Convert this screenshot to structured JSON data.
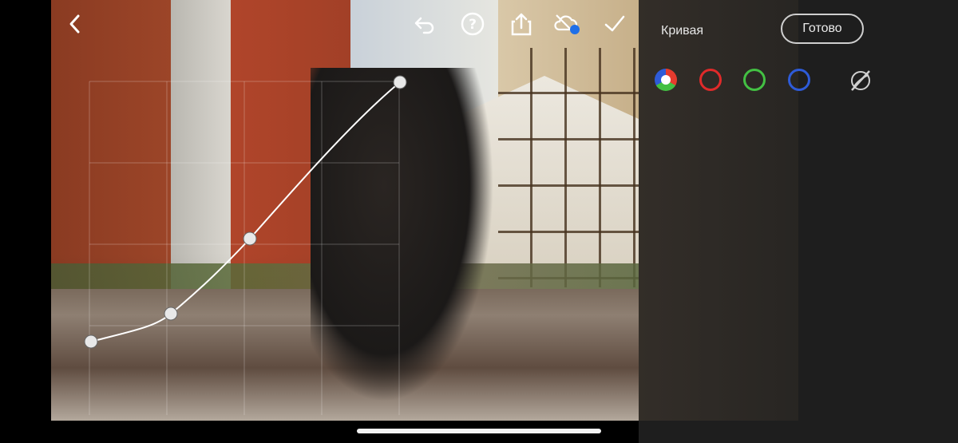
{
  "toolbar": {
    "icons": [
      "back-chevron-icon",
      "undo-icon",
      "help-icon",
      "share-icon",
      "cloud-sync-icon",
      "checkmark-icon"
    ]
  },
  "panel": {
    "title": "Кривая",
    "done_label": "Готово",
    "channels": [
      {
        "name": "rgb-channel",
        "color": "#e63b2e"
      },
      {
        "name": "red-channel",
        "color": "#e02a2a"
      },
      {
        "name": "green-channel",
        "color": "#43c043"
      },
      {
        "name": "blue-channel",
        "color": "#2e5bd8"
      }
    ],
    "accent_blue": "#1f6fe8"
  }
}
